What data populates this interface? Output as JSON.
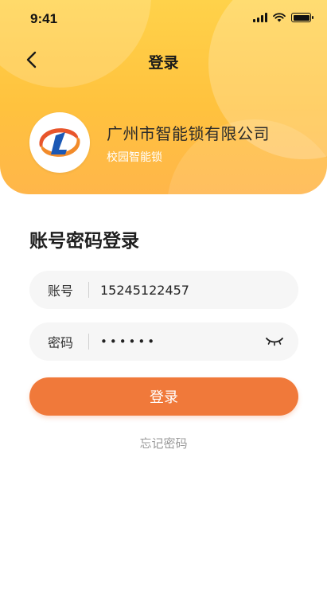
{
  "status_bar": {
    "time": "9:41"
  },
  "nav": {
    "title": "登录"
  },
  "brand": {
    "name": "广州市智能锁有限公司",
    "subtitle": "校园智能锁"
  },
  "login": {
    "section_title": "账号密码登录",
    "account": {
      "label": "账号",
      "value": "15245122457"
    },
    "password": {
      "label": "密码",
      "value": "••••••"
    },
    "submit_label": "登录",
    "forgot_label": "忘记密码"
  },
  "colors": {
    "header_yellow": "#ffc23e",
    "accent_orange": "#f0793a",
    "field_bg": "#f6f6f6"
  },
  "icons": [
    "back-arrow-icon",
    "signal-icon",
    "wifi-icon",
    "battery-icon",
    "company-logo-icon",
    "eye-closed-icon"
  ]
}
